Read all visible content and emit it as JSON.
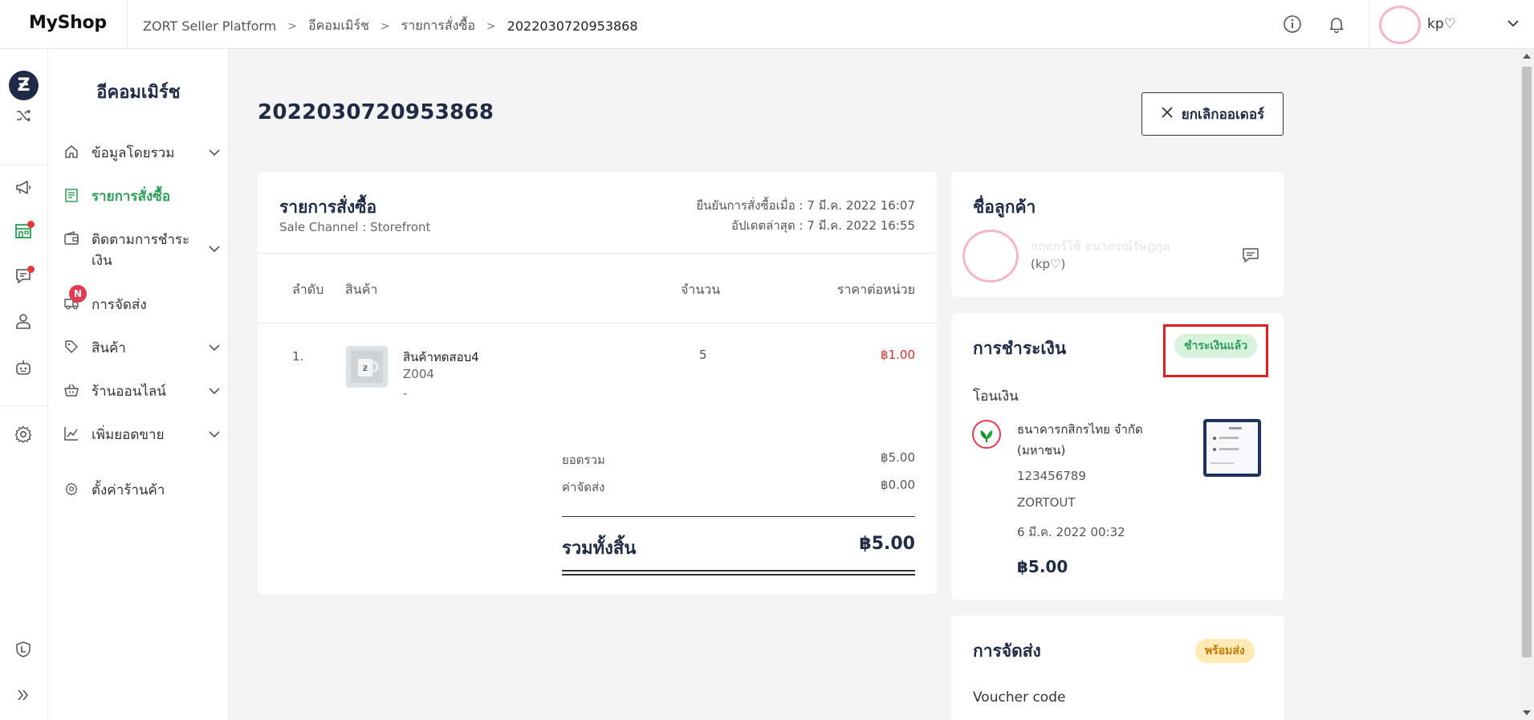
{
  "header": {
    "logo": "MyShop",
    "breadcrumb": [
      "ZORT Seller Platform",
      "อีคอมเมิร์ช",
      "รายการสั่งซื้อ",
      "2022030720953868"
    ],
    "user_name": "kp♡"
  },
  "sidebar": {
    "title": "อีคอมเมิร์ช",
    "items": [
      {
        "label": "ข้อมูลโดยรวม",
        "icon": "home-icon"
      },
      {
        "label": "รายการสั่งซื้อ",
        "icon": "order-list-icon"
      },
      {
        "label": "ติดตามการชำระเงิน",
        "icon": "wallet-icon"
      },
      {
        "label": "การจัดส่ง",
        "icon": "truck-icon",
        "badge": "N"
      },
      {
        "label": "สินค้า",
        "icon": "tag-icon"
      },
      {
        "label": "ร้านออนไลน์",
        "icon": "basket-icon"
      },
      {
        "label": "เพิ่มยอดขาย",
        "icon": "chart-icon"
      },
      {
        "label": "ตั้งค่าร้านค้า",
        "icon": "gear-icon"
      }
    ]
  },
  "order": {
    "id": "2022030720953868",
    "cancel_label": "ยกเลิกออเดอร์",
    "card_title": "รายการสั่งซื้อ",
    "sale_channel": "Sale Channel : Storefront",
    "confirmed": "ยืนยันการสั่งซื้อเมื่อ : 7 มี.ค. 2022 16:07",
    "updated": "อัปเดตล่าสุด : 7 มี.ค. 2022 16:55",
    "columns": {
      "no": "ลำดับ",
      "product": "สินค้า",
      "qty": "จำนวน",
      "unit_price": "ราคาต่อหน่วย"
    },
    "items": [
      {
        "no": "1.",
        "name": "สินค้าทดสอบ4",
        "sku": "Z004",
        "variant": "-",
        "qty": "5",
        "price": "฿1.00"
      }
    ],
    "subtotal_label": "ยอดรวม",
    "subtotal": "฿5.00",
    "shipping_label": "ค่าจัดส่ง",
    "shipping": "฿0.00",
    "total_label": "รวมทั้งสิ้น",
    "total": "฿5.00"
  },
  "customer": {
    "title": "ชื่อลูกค้า",
    "name": "กฤตกร์ใช้ ธนาภรณ์รัษฎกุล",
    "handle": "(kp♡)"
  },
  "payment": {
    "title": "การชำระเงิน",
    "status": "ชำระเงินแล้ว",
    "method": "โอนเงิน",
    "bank": "ธนาคารกสิกรไทย จำกัด (มหาชน)",
    "account": "123456789",
    "ref": "ZORTOUT",
    "date": "6 มี.ค. 2022 00:32",
    "amount": "฿5.00"
  },
  "shipping_card": {
    "title": "การจัดส่ง",
    "status": "พร้อมส่ง",
    "voucher_label": "Voucher code"
  },
  "colors": {
    "accent_green": "#2e9e57",
    "navy": "#1f2a44",
    "price_red": "#d32f2f",
    "paid_bg": "#d7f2dd",
    "ready_bg": "#fdeab4",
    "highlight_red": "#e01f1f"
  }
}
